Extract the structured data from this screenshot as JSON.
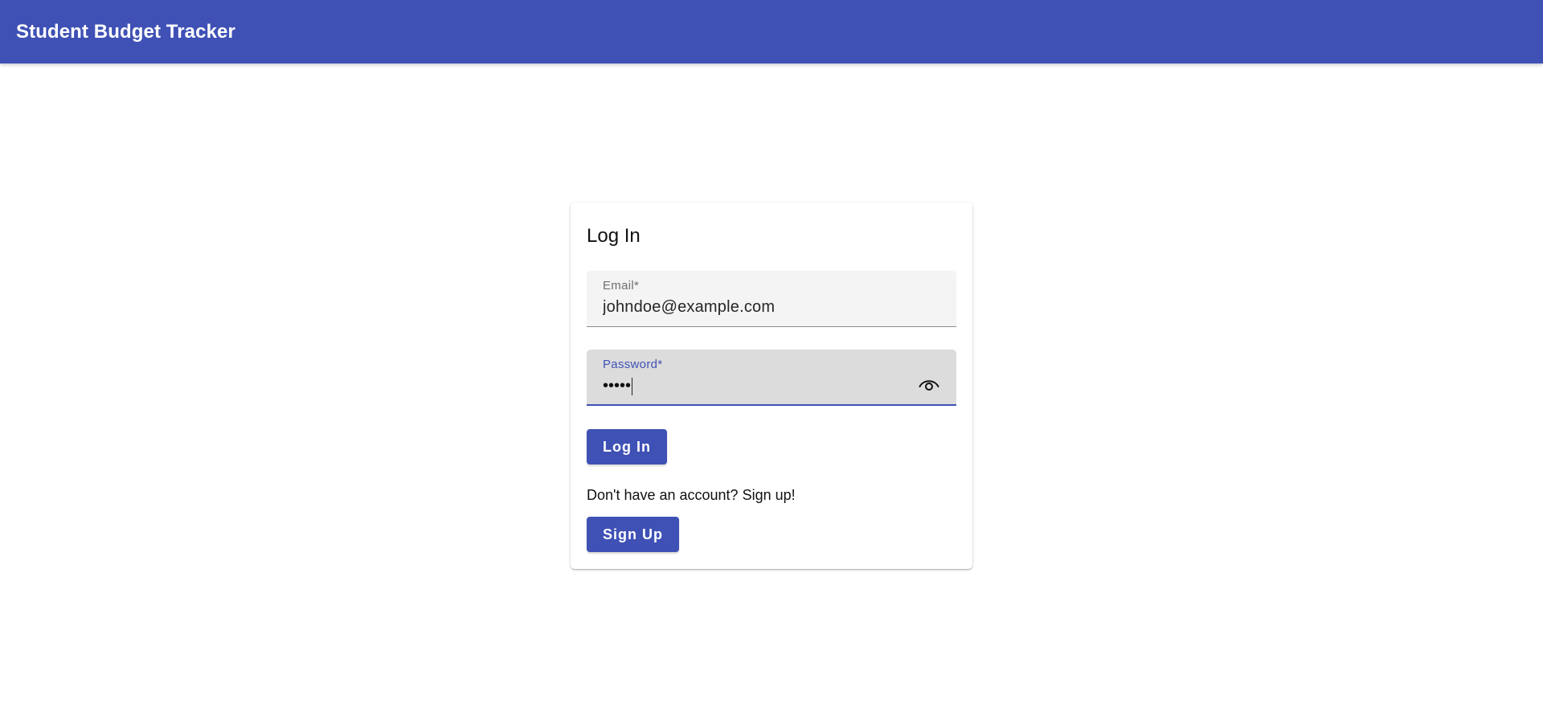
{
  "app_bar": {
    "title": "Student Budget Tracker",
    "color": "#3f51b5"
  },
  "login_card": {
    "title": "Log In",
    "email": {
      "label": "Email*",
      "value": "johndoe@example.com"
    },
    "password": {
      "label": "Password*",
      "masked_value": "•••••",
      "toggle_icon": "eye-icon"
    },
    "login_button_label": "Log In",
    "signup_prompt": "Don't have an account? Sign up!",
    "signup_button_label": "Sign Up"
  }
}
